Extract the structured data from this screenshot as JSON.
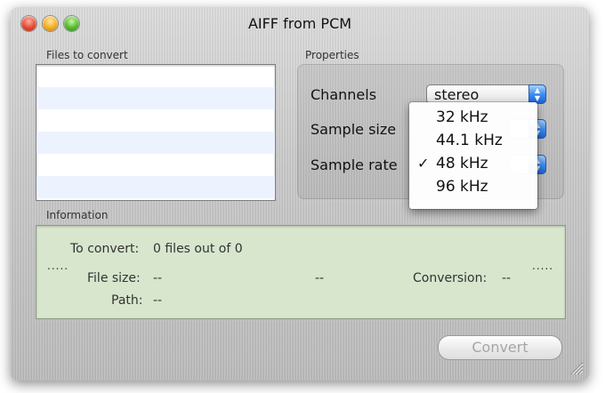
{
  "window": {
    "title": "AIFF from PCM"
  },
  "files_group": {
    "label": "Files to convert",
    "rows": 6
  },
  "properties": {
    "label": "Properties",
    "channels_label": "Channels",
    "channels_value": "stereo",
    "sample_size_label": "Sample size",
    "sample_rate_label": "Sample rate"
  },
  "sample_rate_menu": {
    "options": [
      "32 kHz",
      "44.1 kHz",
      "48 kHz",
      "96 kHz"
    ],
    "selected": "48 kHz",
    "check_glyph": "✓"
  },
  "information": {
    "label": "Information",
    "left_dots": ".....",
    "right_dots": ".....",
    "to_convert_label": "To convert:",
    "to_convert_value": "0 files out of 0",
    "file_size_label": "File size:",
    "file_size_value": "--",
    "middle_value": "--",
    "conversion_label": "Conversion:",
    "conversion_value": "--",
    "path_label": "Path:",
    "path_value": "--"
  },
  "convert_button": {
    "label": "Convert",
    "enabled": false
  },
  "colors": {
    "info_background": "#d7e6cd",
    "list_stripe": "#edf3fe",
    "accent_blue": "#3d8ef3"
  },
  "icons": {
    "close": "close-icon",
    "minimize": "minimize-icon",
    "zoom": "zoom-icon",
    "popup_arrows": "popup-arrows-icon",
    "resize_grip": "resize-grip-icon"
  }
}
